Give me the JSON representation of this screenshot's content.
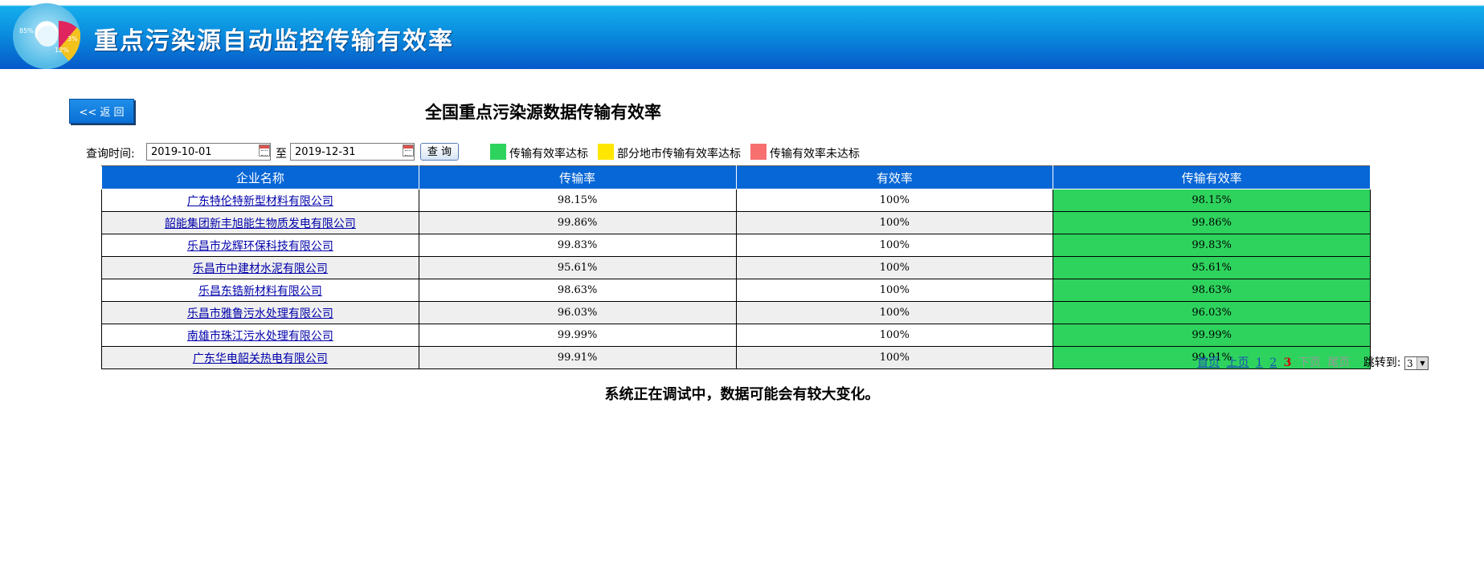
{
  "header": {
    "banner_title": "重点污染源自动监控传输有效率",
    "logo_labels": [
      "85%",
      "3%",
      "12%"
    ]
  },
  "toolbar": {
    "back_label": "<< 返 回",
    "page_title": "全国重点污染源数据传输有效率"
  },
  "filter": {
    "query_time_label": "查询时间:",
    "start_date": "2019-10-01",
    "to_label": "至",
    "end_date": "2019-12-31",
    "query_label": "查 询"
  },
  "legend": [
    {
      "label": "传输有效率达标",
      "color": "#2ed35e"
    },
    {
      "label": "部分地市传输有效率达标",
      "color": "#ffe600"
    },
    {
      "label": "传输有效率未达标",
      "color": "#f76f6f"
    }
  ],
  "table": {
    "headers": [
      "企业名称",
      "传输率",
      "有效率",
      "传输有效率"
    ],
    "rows": [
      [
        "广东特伦特新型材料有限公司",
        "98.15%",
        "100%",
        "98.15%"
      ],
      [
        "韶能集团新丰旭能生物质发电有限公司",
        "99.86%",
        "100%",
        "99.86%"
      ],
      [
        "乐昌市龙辉环保科技有限公司",
        "99.83%",
        "100%",
        "99.83%"
      ],
      [
        "乐昌市中建材水泥有限公司",
        "95.61%",
        "100%",
        "95.61%"
      ],
      [
        "乐昌东锆新材料有限公司",
        "98.63%",
        "100%",
        "98.63%"
      ],
      [
        "乐昌市雅鲁污水处理有限公司",
        "96.03%",
        "100%",
        "96.03%"
      ],
      [
        "南雄市珠江污水处理有限公司",
        "99.99%",
        "100%",
        "99.99%"
      ],
      [
        "广东华电韶关热电有限公司",
        "99.91%",
        "100%",
        "99.91%"
      ]
    ]
  },
  "pager": {
    "first": "首页",
    "prev": "上页",
    "pages": [
      "1",
      "2"
    ],
    "current": "3",
    "next": "下页",
    "last": "尾页",
    "jump_label": "跳转到:",
    "jump_value": "3"
  },
  "notice": "系统正在调试中，数据可能会有较大变化。"
}
